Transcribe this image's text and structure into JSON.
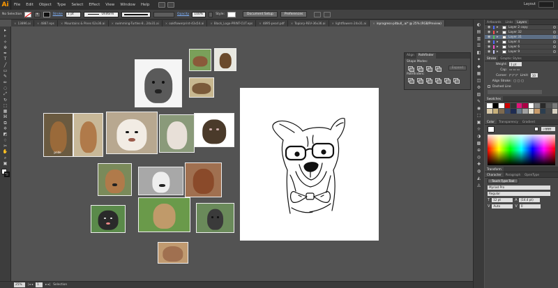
{
  "app": {
    "logo": "Ai",
    "workspace": "Layout"
  },
  "menu": [
    "File",
    "Edit",
    "Object",
    "Type",
    "Select",
    "Effect",
    "View",
    "Window",
    "Help"
  ],
  "control": {
    "selection_label": "No Selection",
    "stroke_label": "Stroke",
    "stroke_weight": "1 pt",
    "uniform": "Uniform",
    "opacity_label": "Opacity",
    "opacity_value": "100%",
    "style_label": "Style:",
    "doc_setup": "Document Setup",
    "preferences": "Preferences"
  },
  "tabs": [
    "13896.ai",
    "4887.eps",
    "Mountains & Pines 62x36.ai",
    "swimming-Turtles-8...24x31.ai",
    "oakflowerprint-43x54.ai",
    "Black_Logo-PRINT-CUT.eps",
    "4895-pearl.pdf",
    "Topiary-REV-36x36.ai",
    "lightflowers-24x31.ai",
    "inprogress-pitbull_.ai* @ 25% (RGB/Preview)"
  ],
  "active_tab_index": 9,
  "tools": [
    "▸",
    "▹",
    "✧",
    "✲",
    "✒",
    "T",
    "╱",
    "▭",
    "✎",
    "✏",
    "◌",
    "⤢",
    "↻",
    "⬚",
    "▦",
    "⌘",
    "⧉",
    "✡",
    "◩",
    "♢",
    "✂",
    "✋",
    "⌕",
    "▣"
  ],
  "canvas": {
    "photo_count": 19,
    "cutout_label": "pride"
  },
  "pathfinder": {
    "tab_align": "Align",
    "tab_pathfinder": "Pathfinder",
    "shape_modes": "Shape Modes:",
    "pathfinders": "Pathfinders:",
    "expand": "Expand"
  },
  "status": {
    "zoom": "25%",
    "artboard": "1",
    "tool": "Selection"
  },
  "layers_panel": {
    "tabs": [
      "Artboards",
      "Links",
      "Layers"
    ],
    "rows": [
      {
        "name": "Layer 2 copy",
        "color": "#4f6cff"
      },
      {
        "name": "Layer 32",
        "color": "#ff5050"
      },
      {
        "name": "Layer 31",
        "color": "#56c756"
      },
      {
        "name": "Layer 4",
        "color": "#4f6cff"
      },
      {
        "name": "Layer 6",
        "color": "#ff4fd3"
      },
      {
        "name": "Layer 9",
        "color": "#c8c8ff"
      }
    ]
  },
  "stroke_panel": {
    "tabs": [
      "Stroke",
      "Graphic Styles"
    ],
    "weight_label": "Weight:",
    "weight": "1 pt",
    "cap_label": "Cap:",
    "corner_label": "Corner:",
    "limit_label": "Limit:",
    "limit": "10",
    "align_label": "Align Stroke:",
    "dashed": "Dashed Line"
  },
  "swatches": {
    "title": "Swatches",
    "colors": [
      "#ffffff",
      "#000000",
      "#ffffff",
      "#cc0000",
      "#333333",
      "#e0147a",
      "#aa0044",
      "#ffffff",
      "#888888",
      "#2a2a2a",
      "#555555",
      "#7a7a7a",
      "#d9c9a8",
      "#c7b07a",
      "#7e6a4f",
      "#3a4a6a",
      "#1e2c52",
      "#6a7a8a",
      "#a0a0a0",
      "#e9e3d2",
      "#c79a6a",
      "#2c3e50",
      "#4a4a4a",
      "#d6cfc0"
    ]
  },
  "color_panel": {
    "tabs": [
      "Color",
      "Transparency",
      "Gradient"
    ],
    "hex": "ffffff"
  },
  "transform_panel": {
    "title": "Transform"
  },
  "character_panel": {
    "tabs": [
      "Character",
      "Paragraph",
      "OpenType"
    ],
    "touch": "Touch Type Tool",
    "font": "Myriad Pro",
    "style": "Regular",
    "size": "12 pt",
    "leading": "(14.4 pt)",
    "tracking": "Auto",
    "kerning": "0"
  }
}
